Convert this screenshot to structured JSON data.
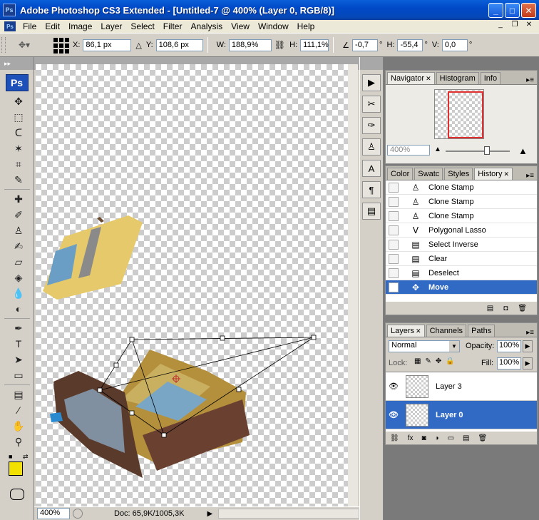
{
  "window": {
    "title": "Adobe Photoshop CS3 Extended - [Untitled-7 @ 400% (Layer 0, RGB/8)]",
    "app_icon_label": "Ps",
    "minimize_label": "_",
    "maximize_label": "□",
    "close_label": "✕"
  },
  "menubar": {
    "items": [
      "File",
      "Edit",
      "Image",
      "Layer",
      "Select",
      "Filter",
      "Analysis",
      "View",
      "Window",
      "Help"
    ],
    "doc_controls": [
      "_",
      "❐",
      "✕"
    ]
  },
  "options": {
    "x_label": "X:",
    "x_value": "86,1 px",
    "y_label": "Y:",
    "y_value": "108,6 px",
    "w_label": "W:",
    "w_value": "188,9%",
    "h_label": "H:",
    "h_value": "111,1%",
    "rotate_value": "-0,7",
    "rotate_unit": "°",
    "hskew_label": "H:",
    "hskew_value": "-55,4",
    "hskew_unit": "°",
    "vskew_label": "V:",
    "vskew_value": "0,0",
    "vskew_unit": "°"
  },
  "toolbox": {
    "logo": "Ps",
    "foreground_color": "#f2e000",
    "tools": [
      "move-tool-icon",
      "marquee-tool-icon",
      "lasso-tool-icon",
      "magic-wand-icon",
      "crop-tool-icon",
      "eyedropper-tool-icon",
      "healing-brush-icon",
      "brush-tool-icon",
      "clone-stamp-icon",
      "history-brush-icon",
      "eraser-tool-icon",
      "paint-bucket-icon",
      "blur-tool-icon",
      "dodge-tool-icon",
      "pen-tool-icon",
      "type-tool-icon",
      "path-selection-icon",
      "shape-tool-icon",
      "notes-tool-icon",
      "eyedropper-2-icon",
      "hand-tool-icon",
      "zoom-tool-icon"
    ]
  },
  "document": {
    "zoom": "400%",
    "doc_info": "Doc: 65,9K/1005,3K"
  },
  "navigator": {
    "tabs": [
      "Navigator",
      "Histogram",
      "Info"
    ],
    "zoom": "400%"
  },
  "history": {
    "tabs": [
      "Color",
      "Swatc",
      "Styles",
      "History"
    ],
    "items": [
      {
        "label": "Clone Stamp",
        "icon": "clone-stamp-icon"
      },
      {
        "label": "Clone Stamp",
        "icon": "clone-stamp-icon"
      },
      {
        "label": "Clone Stamp",
        "icon": "clone-stamp-icon"
      },
      {
        "label": "Polygonal Lasso",
        "icon": "polygonal-lasso-icon"
      },
      {
        "label": "Select Inverse",
        "icon": "document-step-icon"
      },
      {
        "label": "Clear",
        "icon": "document-step-icon"
      },
      {
        "label": "Deselect",
        "icon": "document-step-icon"
      },
      {
        "label": "Move",
        "icon": "move-tool-icon"
      }
    ]
  },
  "layers": {
    "tabs": [
      "Layers",
      "Channels",
      "Paths"
    ],
    "blend_mode": "Normal",
    "opacity_label": "Opacity:",
    "opacity": "100%",
    "lock_label": "Lock:",
    "fill_label": "Fill:",
    "fill": "100%",
    "items": [
      {
        "name": "Layer 3",
        "selected": false
      },
      {
        "name": "Layer 0",
        "selected": true
      }
    ]
  }
}
